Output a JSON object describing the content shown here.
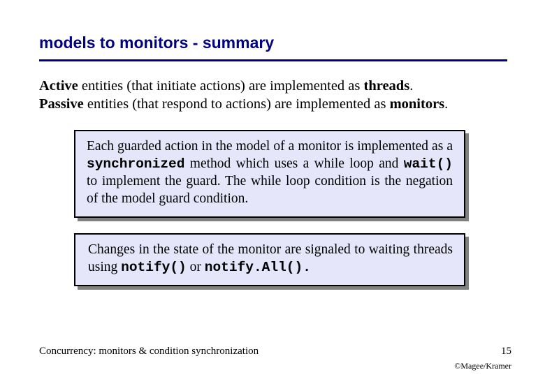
{
  "title": "models to monitors - summary",
  "body": {
    "line1": {
      "prefix": "Active",
      "mid": " entities (that initiate actions) are implemented as ",
      "suffix": "threads",
      "end": "."
    },
    "line2": {
      "prefix": "Passive",
      "mid": " entities (that respond to actions) are implemented as ",
      "suffix": "monitors",
      "end": "."
    }
  },
  "box1": {
    "part1": "Each guarded action in the model of a monitor is implemented as a ",
    "code1": "synchronized",
    "part2": " method which uses a while loop and ",
    "code2": "wait()",
    "part3": " to implement the guard. The while loop condition is the negation of the model guard condition."
  },
  "box2": {
    "part1": "Changes in the state of the monitor are signaled to waiting threads using ",
    "code1": "notify()",
    "part2": " or ",
    "code2": "notify.All().",
    "part3": ""
  },
  "footer": {
    "left": "Concurrency: monitors & condition synchronization",
    "right": "15"
  },
  "credit": "©Magee/Kramer"
}
